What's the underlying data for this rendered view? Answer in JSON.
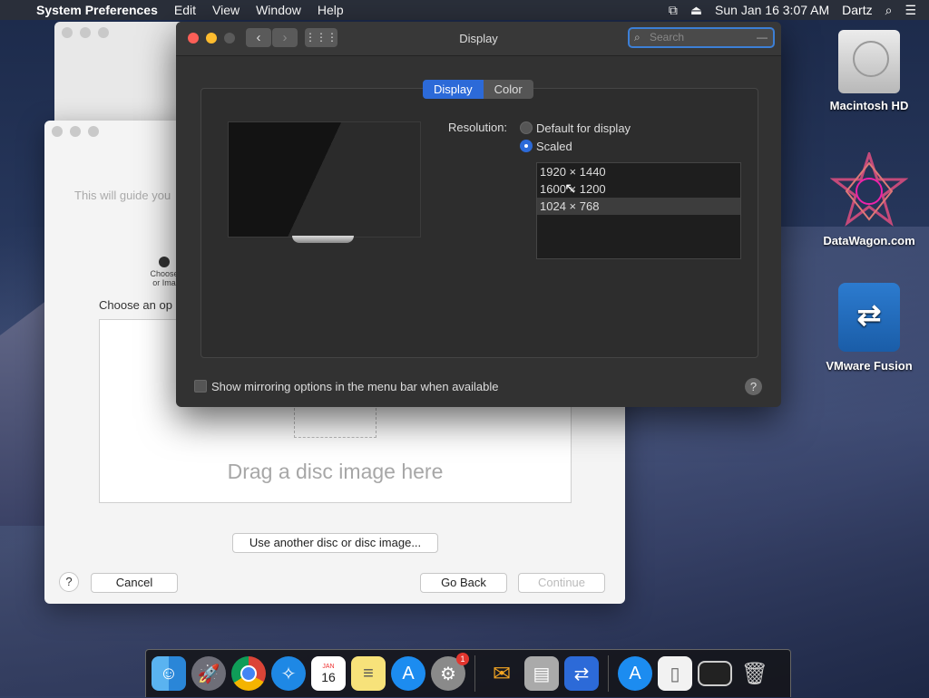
{
  "menubar": {
    "app": "System Preferences",
    "items": [
      "Edit",
      "View",
      "Window",
      "Help"
    ],
    "clock": "Sun Jan 16  3:07 AM",
    "user": "Dartz"
  },
  "installer": {
    "intro_text": "This will guide you",
    "step_label": "Choose\nor Ima",
    "choose_label": "Choose an op",
    "drop_text": "Drag a disc image here",
    "another_button": "Use another disc or disc image...",
    "cancel_button": "Cancel",
    "goback_button": "Go Back",
    "continue_button": "Continue",
    "help": "?"
  },
  "prefs": {
    "title": "Display",
    "search_placeholder": "Search",
    "tabs": [
      "Display",
      "Color"
    ],
    "resolution_label": "Resolution:",
    "option_default": "Default for display",
    "option_scaled": "Scaled",
    "resolutions": [
      "1920 × 1440",
      "1600 × 1200",
      "1024 × 768"
    ],
    "selected_resolution": "1024 × 768",
    "mirroring_label": "Show mirroring options in the menu bar when available",
    "help": "?"
  },
  "desktop": {
    "icons": [
      "Macintosh HD",
      "DataWagon.com",
      "VMware Fusion"
    ]
  },
  "dock": {
    "badge_count": "1",
    "calendar_day": "16",
    "calendar_month": "JAN"
  },
  "colors": {
    "accent": "#2c6ad8",
    "close": "#fc5f57",
    "minimize": "#febc2e"
  }
}
